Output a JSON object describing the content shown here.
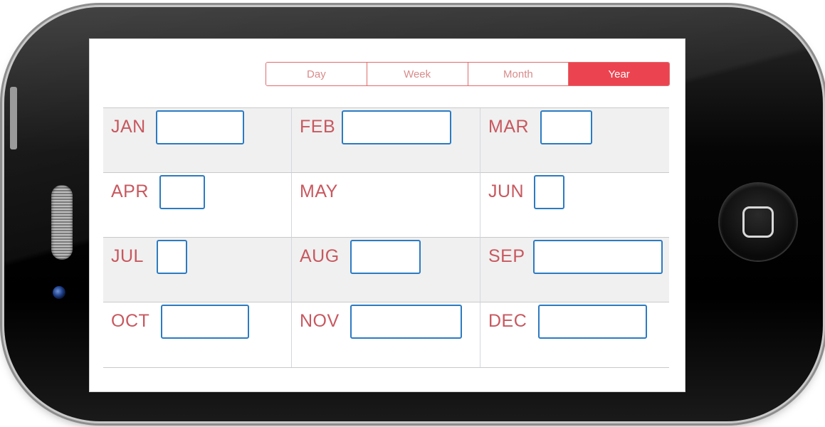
{
  "tabs": [
    {
      "label": "Day",
      "active": false
    },
    {
      "label": "Week",
      "active": false
    },
    {
      "label": "Month",
      "active": false
    },
    {
      "label": "Year",
      "active": true
    }
  ],
  "months": [
    {
      "label": "JAN"
    },
    {
      "label": "FEB"
    },
    {
      "label": "MAR"
    },
    {
      "label": "APR"
    },
    {
      "label": "MAY"
    },
    {
      "label": "JUN"
    },
    {
      "label": "JUL"
    },
    {
      "label": "AUG"
    },
    {
      "label": "SEP"
    },
    {
      "label": "OCT"
    },
    {
      "label": "NOV"
    },
    {
      "label": "DEC"
    }
  ],
  "colors": {
    "accent": "#ec4350",
    "month_text": "#c8585f",
    "box_border": "#2b7bc2"
  }
}
